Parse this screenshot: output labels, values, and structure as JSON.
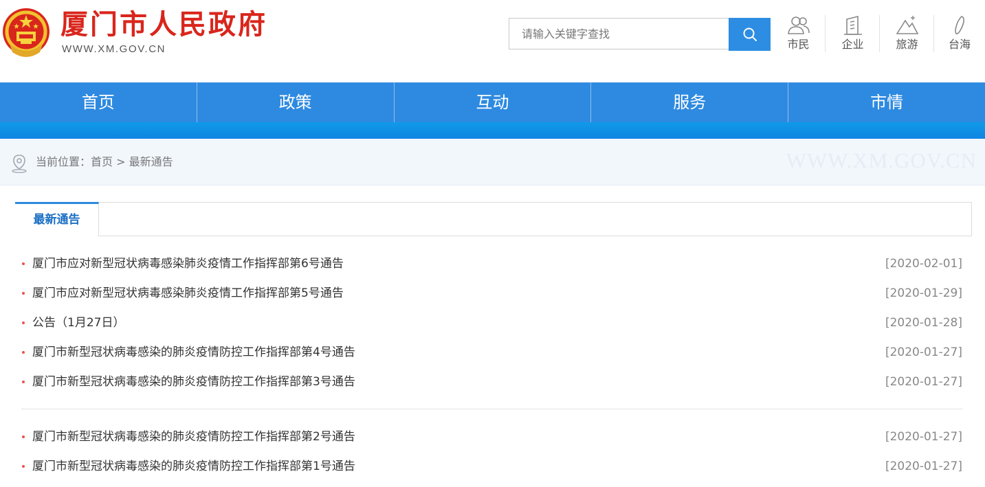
{
  "header": {
    "site_title": "厦门市人民政府",
    "site_url": "WWW.XM.GOV.CN",
    "search": {
      "placeholder": "请输入关键字查找"
    },
    "quick_links": [
      {
        "label": "市民",
        "icon": "citizen-icon"
      },
      {
        "label": "企业",
        "icon": "enterprise-icon"
      },
      {
        "label": "旅游",
        "icon": "tourism-icon"
      },
      {
        "label": "台海",
        "icon": "taiwan-icon"
      }
    ]
  },
  "nav": {
    "items": [
      "首页",
      "政策",
      "互动",
      "服务",
      "市情"
    ]
  },
  "breadcrumb": {
    "prefix": "当前位置：",
    "home": "首页",
    "separator": " > ",
    "current": "最新通告",
    "watermark": "WWW.XM.GOV.CN"
  },
  "content": {
    "tab_label": "最新通告",
    "group1": [
      {
        "title": "厦门市应对新型冠状病毒感染肺炎疫情工作指挥部第6号通告",
        "date": "[2020-02-01]"
      },
      {
        "title": "厦门市应对新型冠状病毒感染肺炎疫情工作指挥部第5号通告",
        "date": "[2020-01-29]"
      },
      {
        "title": "公告（1月27日）",
        "date": "[2020-01-28]"
      },
      {
        "title": "厦门市新型冠状病毒感染的肺炎疫情防控工作指挥部第4号通告",
        "date": "[2020-01-27]"
      },
      {
        "title": "厦门市新型冠状病毒感染的肺炎疫情防控工作指挥部第3号通告",
        "date": "[2020-01-27]"
      }
    ],
    "group2": [
      {
        "title": "厦门市新型冠状病毒感染的肺炎疫情防控工作指挥部第2号通告",
        "date": "[2020-01-27]"
      },
      {
        "title": "厦门市新型冠状病毒感染的肺炎疫情防控工作指挥部第1号通告",
        "date": "[2020-01-27]"
      }
    ]
  },
  "colors": {
    "brand_red": "#d9261c",
    "nav_blue": "#2e8ae0",
    "tab_text": "#1a6fc4",
    "bullet": "#e8544a"
  }
}
